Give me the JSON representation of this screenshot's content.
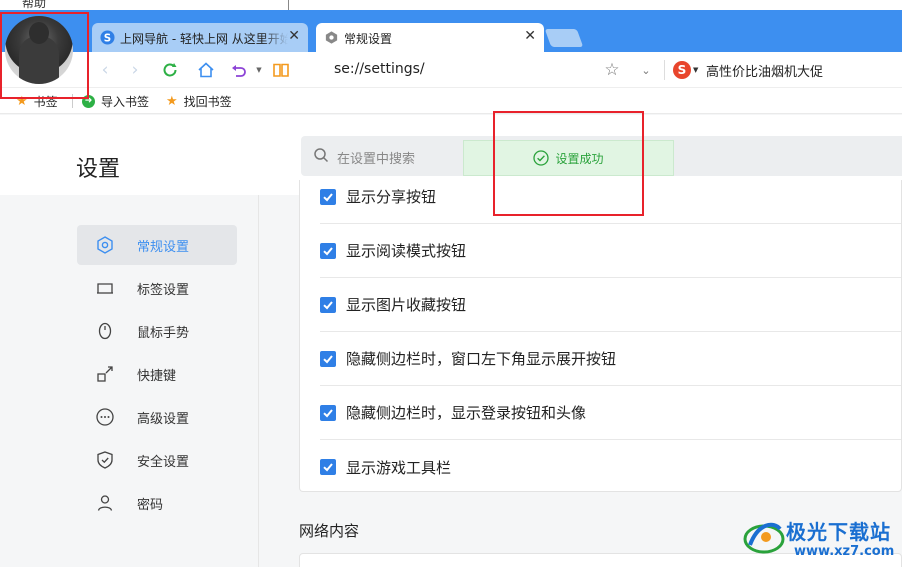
{
  "menu": {
    "help_label": "帮助"
  },
  "tabs": [
    {
      "title": "上网导航 - 轻快上网 从这里开始",
      "icon": "sogou-s-icon",
      "active": false
    },
    {
      "title": "常规设置",
      "icon": "settings-hex-icon",
      "active": true
    }
  ],
  "toolbar": {
    "url": "se://settings/",
    "search_engine_letter": "S",
    "ad_text": "高性价比油烟机大促"
  },
  "bookmarks": [
    {
      "label": "书签",
      "icon": "star-icon"
    },
    {
      "label": "导入书签",
      "icon": "import-icon"
    },
    {
      "label": "找回书签",
      "icon": "star-icon"
    }
  ],
  "settings": {
    "title": "设置",
    "search_placeholder": "在设置中搜索",
    "toast": "设置成功"
  },
  "sidebar": {
    "items": [
      {
        "label": "常规设置",
        "icon": "hexagon-icon",
        "active": true
      },
      {
        "label": "标签设置",
        "icon": "tab-icon",
        "active": false
      },
      {
        "label": "鼠标手势",
        "icon": "mouse-icon",
        "active": false
      },
      {
        "label": "快捷键",
        "icon": "shortcut-icon",
        "active": false
      },
      {
        "label": "高级设置",
        "icon": "more-icon",
        "active": false
      },
      {
        "label": "安全设置",
        "icon": "shield-icon",
        "active": false
      },
      {
        "label": "密码",
        "icon": "user-icon",
        "active": false
      }
    ]
  },
  "options": [
    {
      "label": "显示分享按钮",
      "checked": true
    },
    {
      "label": "显示阅读模式按钮",
      "checked": true
    },
    {
      "label": "显示图片收藏按钮",
      "checked": true
    },
    {
      "label": "隐藏侧边栏时，窗口左下角显示展开按钮",
      "checked": true
    },
    {
      "label": "隐藏侧边栏时，显示登录按钮和头像",
      "checked": true
    },
    {
      "label": "显示游戏工具栏",
      "checked": true
    }
  ],
  "sections": {
    "network_title": "网络内容"
  },
  "watermark": {
    "brand": "极光下载站",
    "url": "www.xz7.com"
  },
  "colors": {
    "tab_bar": "#3d8ff0",
    "accent": "#2f7fe6",
    "toast_green": "#2aa23b",
    "highlight_red": "#e8222b"
  }
}
